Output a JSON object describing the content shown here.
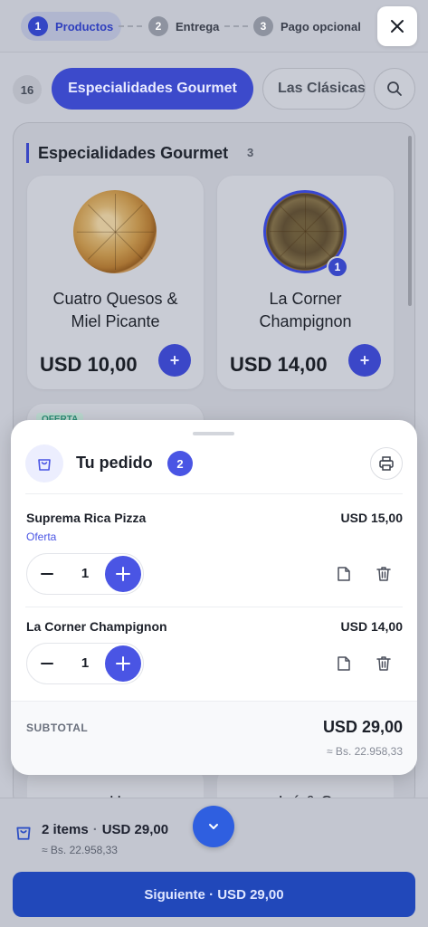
{
  "steps": [
    {
      "number": "1",
      "label": "Productos"
    },
    {
      "number": "2",
      "label": "Entrega"
    },
    {
      "number": "3",
      "label": "Pago opcional"
    }
  ],
  "categories": {
    "count": "16",
    "active": "Especialidades Gourmet",
    "next": "Las Clásicas"
  },
  "section": {
    "title": "Especialidades Gourmet",
    "count": "3"
  },
  "products": [
    {
      "name_line1": "Cuatro Quesos &",
      "name_line2": "Miel Picante",
      "price": "USD 10,00",
      "add": "+"
    },
    {
      "name_line1": "La Corner",
      "name_line2": "Champignon",
      "price": "USD 14,00",
      "add": "+",
      "in_cart": "1"
    }
  ],
  "peek": {
    "offer_tag": "OFERTA",
    "left_name": "H",
    "right_name": "L   ó  & C"
  },
  "order": {
    "title": "Tu pedido",
    "count": "2",
    "items": [
      {
        "name": "Suprema Rica Pizza",
        "tag": "Oferta",
        "price": "USD 15,00",
        "qty": "1"
      },
      {
        "name": "La Corner Champignon",
        "price": "USD 14,00",
        "qty": "1"
      }
    ],
    "subtotal_label": "SUBTOTAL",
    "subtotal": "USD 29,00",
    "subtotal_alt": "≈ Bs. 22.958,33"
  },
  "bottom": {
    "items": "2 items",
    "dot": "·",
    "total": "USD 29,00",
    "alt": "≈ Bs. 22.958,33",
    "next_label": "Siguiente · USD 29,00"
  },
  "colors": {
    "accent": "#4a55e4",
    "primary_button": "#2148ba",
    "offer": "#2b8c74"
  }
}
